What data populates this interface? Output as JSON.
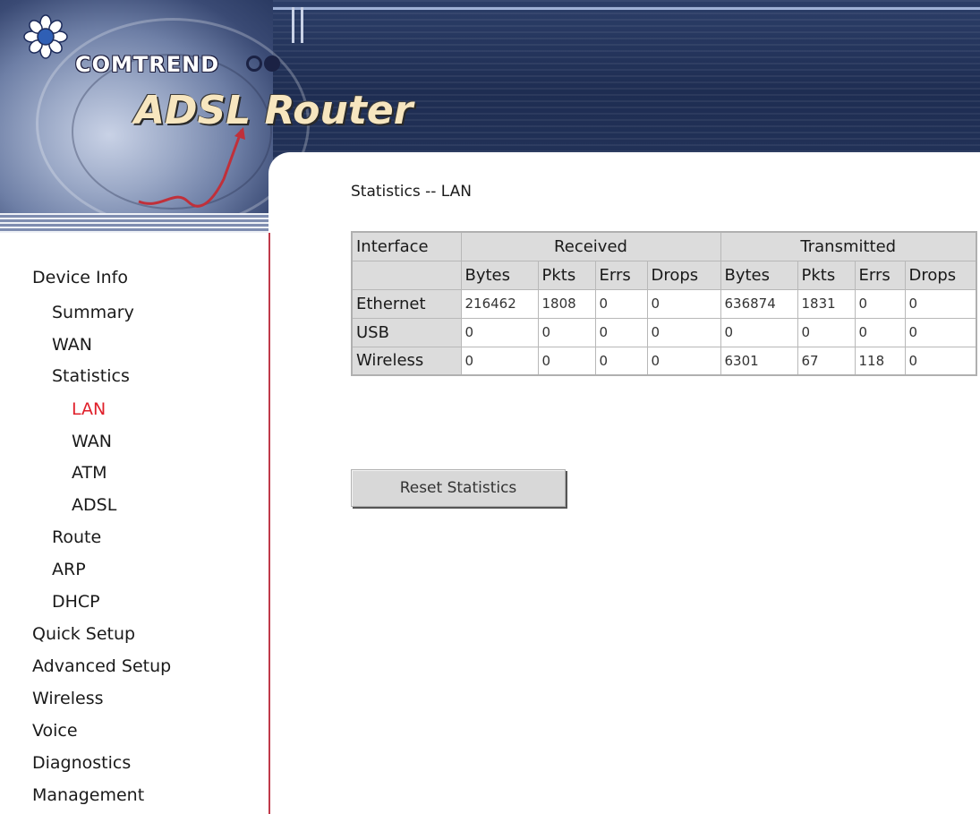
{
  "brand": {
    "name": "COMTREND",
    "product": "ADSL Router"
  },
  "sidebar": {
    "items": [
      {
        "label": "Device Info",
        "level": 0,
        "active": false
      },
      {
        "label": "Summary",
        "level": 1,
        "active": false
      },
      {
        "label": "WAN",
        "level": 1,
        "active": false
      },
      {
        "label": "Statistics",
        "level": 1,
        "active": false
      },
      {
        "label": "LAN",
        "level": 2,
        "active": true
      },
      {
        "label": "WAN",
        "level": 2,
        "active": false
      },
      {
        "label": "ATM",
        "level": 2,
        "active": false
      },
      {
        "label": "ADSL",
        "level": 2,
        "active": false
      },
      {
        "label": "Route",
        "level": 1,
        "active": false
      },
      {
        "label": "ARP",
        "level": 1,
        "active": false
      },
      {
        "label": "DHCP",
        "level": 1,
        "active": false
      },
      {
        "label": "Quick Setup",
        "level": 0,
        "active": false
      },
      {
        "label": "Advanced Setup",
        "level": 0,
        "active": false
      },
      {
        "label": "Wireless",
        "level": 0,
        "active": false
      },
      {
        "label": "Voice",
        "level": 0,
        "active": false
      },
      {
        "label": "Diagnostics",
        "level": 0,
        "active": false
      },
      {
        "label": "Management",
        "level": 0,
        "active": false
      }
    ]
  },
  "main": {
    "title": "Statistics -- LAN",
    "table": {
      "interface_header": "Interface",
      "received_header": "Received",
      "transmitted_header": "Transmitted",
      "sub_headers": [
        "Bytes",
        "Pkts",
        "Errs",
        "Drops",
        "Bytes",
        "Pkts",
        "Errs",
        "Drops"
      ],
      "rows": [
        {
          "interface": "Ethernet",
          "values": [
            "216462",
            "1808",
            "0",
            "0",
            "636874",
            "1831",
            "0",
            "0"
          ]
        },
        {
          "interface": "USB",
          "values": [
            "0",
            "0",
            "0",
            "0",
            "0",
            "0",
            "0",
            "0"
          ]
        },
        {
          "interface": "Wireless",
          "values": [
            "0",
            "0",
            "0",
            "0",
            "6301",
            "67",
            "118",
            "0"
          ]
        }
      ]
    },
    "reset_button": "Reset Statistics"
  },
  "colors": {
    "active_nav": "#e01f2a",
    "header_blue": "#1e2d52",
    "table_header_bg": "#dcdcdc",
    "sidebar_border": "#c03a4a"
  }
}
